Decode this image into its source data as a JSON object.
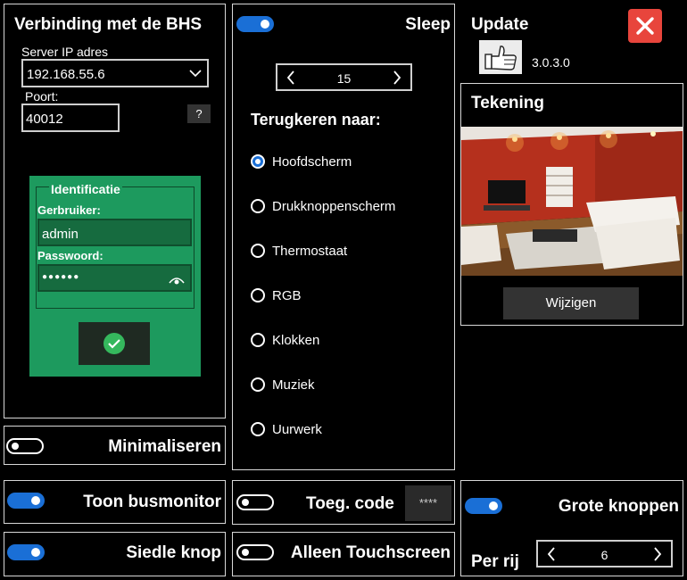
{
  "connection": {
    "title": "Verbinding met de BHS",
    "server_label": "Server IP adres",
    "server_value": "192.168.55.6",
    "port_label": "Poort:",
    "port_value": "40012",
    "help_label": "?",
    "identification": {
      "title": "Identificatie",
      "user_label": "Gerbruiker:",
      "user_value": "admin",
      "password_label": "Passwoord:",
      "password_value": "●●●●●●"
    }
  },
  "sleep": {
    "label": "Sleep",
    "enabled": true,
    "stepper_value": "15",
    "return_title": "Terugkeren naar:",
    "options": [
      "Hoofdscherm",
      "Drukknoppenscherm",
      "Thermostaat",
      "RGB",
      "Klokken",
      "Muziek",
      "Uurwerk"
    ],
    "selected": "Hoofdscherm"
  },
  "update": {
    "title": "Update",
    "version": "3.0.3.0"
  },
  "drawing": {
    "title": "Tekening",
    "change_button": "Wijzigen"
  },
  "settings": {
    "minimize": {
      "label": "Minimaliseren",
      "enabled": false
    },
    "busmonitor": {
      "label": "Toon busmonitor",
      "enabled": true
    },
    "siedle": {
      "label": "Siedle knop",
      "enabled": true
    },
    "access_code": {
      "label": "Toeg. code",
      "enabled": false,
      "value": "****"
    },
    "touchscreen": {
      "label": "Alleen Touchscreen",
      "enabled": false
    },
    "big_buttons": {
      "label": "Grote knoppen",
      "enabled": true,
      "per_row_label": "Per rij",
      "per_row_value": "6"
    }
  },
  "colors": {
    "accent": "#1a6fd6",
    "close_red": "#e8453c",
    "green_panel": "#1d9a5e"
  }
}
